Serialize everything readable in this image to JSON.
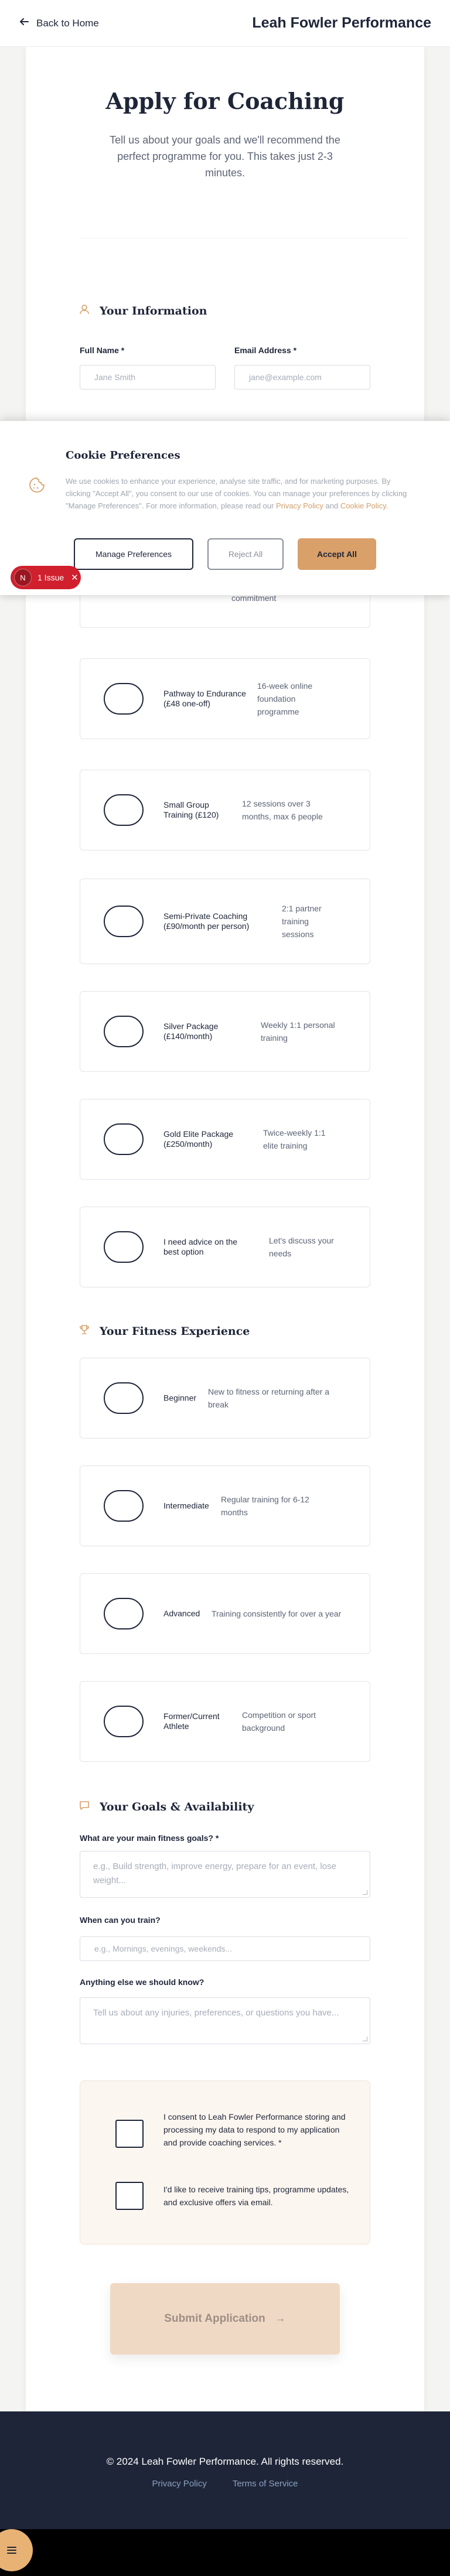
{
  "header": {
    "back_label": "Back to Home",
    "brand": "Leah Fowler Performance"
  },
  "hero": {
    "title": "Apply for Coaching",
    "intro": "Tell us about your goals and we'll recommend the perfect programme for you. This takes just 2-3 minutes."
  },
  "info": {
    "section_title": "Your Information",
    "full_name_label": "Full Name *",
    "full_name_placeholder": "Jane Smith",
    "email_label": "Email Address *",
    "email_placeholder": "jane@example.com",
    "partial_text": "commitment"
  },
  "programmes": [
    {
      "name": "Pathway to Endurance (£48 one-off)",
      "desc": "16-week online foundation programme"
    },
    {
      "name": "Small Group Training (£120)",
      "desc": "12 sessions over 3 months, max 6 people"
    },
    {
      "name": "Semi-Private Coaching (£90/month per person)",
      "desc": "2:1 partner training sessions"
    },
    {
      "name": "Silver Package (£140/month)",
      "desc": "Weekly 1:1 personal training"
    },
    {
      "name": "Gold Elite Package (£250/month)",
      "desc": "Twice-weekly 1:1 elite training"
    },
    {
      "name": "I need advice on the best option",
      "desc": "Let's discuss your needs"
    }
  ],
  "experience": {
    "section_title": "Your Fitness Experience",
    "options": [
      {
        "name": "Beginner",
        "desc": "New to fitness or returning after a break"
      },
      {
        "name": "Intermediate",
        "desc": "Regular training for 6-12 months"
      },
      {
        "name": "Advanced",
        "desc": "Training consistently for over a year"
      },
      {
        "name": "Former/Current Athlete",
        "desc": "Competition or sport background"
      }
    ]
  },
  "goals": {
    "section_title": "Your Goals & Availability",
    "goals_label": "What are your main fitness goals? *",
    "goals_placeholder": "e.g., Build strength, improve energy, prepare for an event, lose weight...",
    "train_label": "When can you train?",
    "train_placeholder": "e.g., Mornings, evenings, weekends...",
    "else_label": "Anything else we should know?",
    "else_placeholder": "Tell us about any injuries, preferences, or questions you have..."
  },
  "consent": {
    "data_consent": "I consent to Leah Fowler Performance storing and processing my data to respond to my application and provide coaching services. *",
    "marketing_consent": "I'd like to receive training tips, programme updates, and exclusive offers via email."
  },
  "submit": {
    "label": "Submit Application",
    "arrow": "→"
  },
  "footer": {
    "copyright": "© 2024 Leah Fowler Performance. All rights reserved.",
    "privacy": "Privacy Policy",
    "terms": "Terms of Service"
  },
  "cookie_banner": {
    "title": "Cookie Preferences",
    "body_main": "We use cookies to enhance your experience, analyse site traffic, and for marketing purposes. By clicking \"Accept All\", you consent to our use of cookies. You can manage your preferences by clicking \"Manage Preferences\". For more information, please read our ",
    "privacy_link": "Privacy Policy",
    "and": " and ",
    "cookie_link": "Cookie Policy",
    "period": ".",
    "manage_label": "Manage Preferences",
    "reject_label": "Reject All",
    "accept_label": "Accept All"
  },
  "dev_issue": {
    "letter": "N",
    "label": "1 Issue",
    "close": "✕"
  },
  "fab_icon": "menu-icon",
  "colors": {
    "navy": "#1e2538",
    "accent": "#d9a06a",
    "submit_bg": "#f0d9c4",
    "issue_red": "#d0202e"
  }
}
